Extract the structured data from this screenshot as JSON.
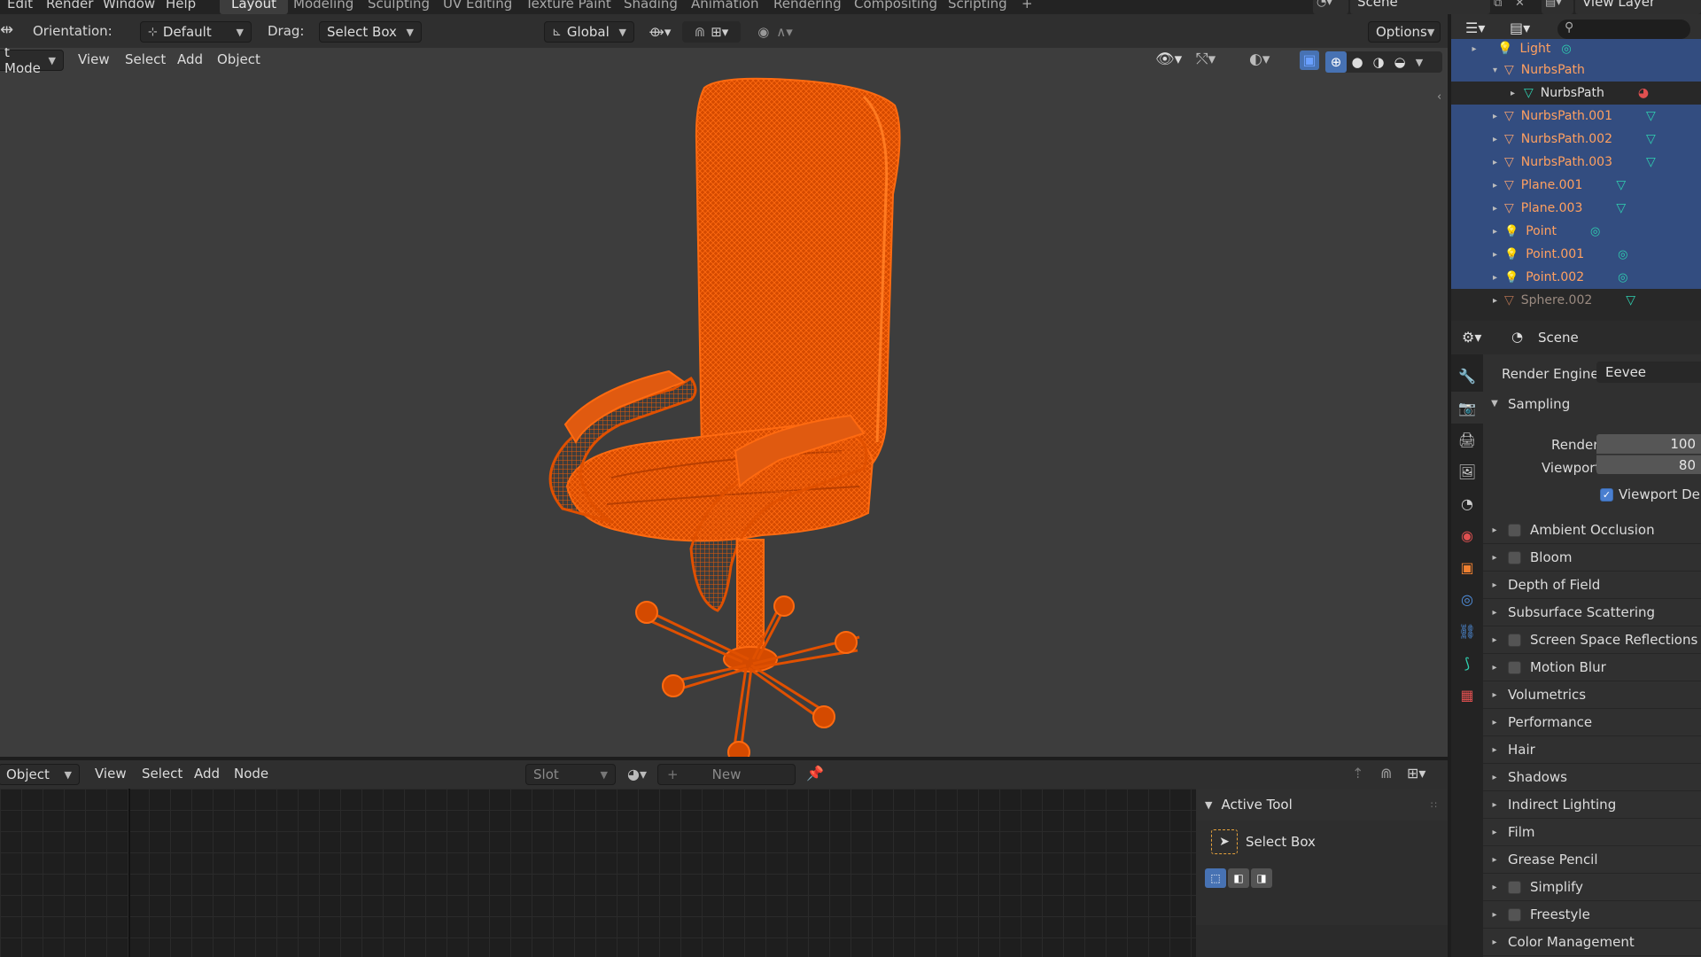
{
  "topbar": {
    "menus": [
      "Edit",
      "Render",
      "Window",
      "Help"
    ],
    "workspaces": [
      {
        "label": "Layout",
        "active": true
      },
      {
        "label": "Modeling",
        "active": false
      },
      {
        "label": "Sculpting",
        "active": false
      },
      {
        "label": "UV Editing",
        "active": false
      },
      {
        "label": "Texture Paint",
        "active": false
      },
      {
        "label": "Shading",
        "active": false
      },
      {
        "label": "Animation",
        "active": false
      },
      {
        "label": "Rendering",
        "active": false
      },
      {
        "label": "Compositing",
        "active": false
      },
      {
        "label": "Scripting",
        "active": false
      }
    ],
    "add_tab": "+",
    "scene_name": "Scene",
    "view_layer": "View Layer"
  },
  "toolhdr": {
    "orientation_label": "Orientation:",
    "orientation_value": "Default",
    "drag_label": "Drag:",
    "drag_value": "Select Box",
    "transform_value": "Global",
    "options_label": "Options"
  },
  "viewport": {
    "mode": "t Mode",
    "menus": [
      "View",
      "Select",
      "Add",
      "Object"
    ],
    "object_color": "#e05000"
  },
  "bottom": {
    "mode": "Object",
    "menus": [
      "View",
      "Select",
      "Add",
      "Node"
    ],
    "slot_label": "Slot",
    "new_label": "New",
    "active_tool_title": "Active Tool",
    "active_tool_name": "Select Box"
  },
  "outliner": {
    "items": [
      {
        "name": "Light",
        "type": "light",
        "sel": true,
        "depth": 0
      },
      {
        "name": "NurbsPath",
        "type": "curve",
        "sel": true,
        "depth": 0,
        "expanded": true
      },
      {
        "name": "NurbsPath",
        "type": "data",
        "sel": false,
        "depth": 1
      },
      {
        "name": "NurbsPath.001",
        "type": "curve",
        "sel": true,
        "depth": 0
      },
      {
        "name": "NurbsPath.002",
        "type": "curve",
        "sel": true,
        "depth": 0
      },
      {
        "name": "NurbsPath.003",
        "type": "curve",
        "sel": true,
        "depth": 0
      },
      {
        "name": "Plane.001",
        "type": "mesh",
        "sel": true,
        "depth": 0
      },
      {
        "name": "Plane.003",
        "type": "mesh",
        "sel": true,
        "depth": 0
      },
      {
        "name": "Point",
        "type": "light",
        "sel": true,
        "depth": 0
      },
      {
        "name": "Point.001",
        "type": "light",
        "sel": true,
        "depth": 0
      },
      {
        "name": "Point.002",
        "type": "light",
        "sel": true,
        "depth": 0
      },
      {
        "name": "Sphere.002",
        "type": "mesh",
        "sel": false,
        "depth": 0
      }
    ]
  },
  "properties": {
    "context": "Scene",
    "render_engine_label": "Render Engine",
    "render_engine_value": "Eevee",
    "sampling_label": "Sampling",
    "render_label": "Render",
    "render_value": "100",
    "viewport_label": "Viewport",
    "viewport_value": "80",
    "viewport_denoise": "Viewport Deno",
    "panels": [
      {
        "label": "Ambient Occlusion",
        "checkbox": true
      },
      {
        "label": "Bloom",
        "checkbox": true
      },
      {
        "label": "Depth of Field",
        "checkbox": false
      },
      {
        "label": "Subsurface Scattering",
        "checkbox": false
      },
      {
        "label": "Screen Space Reflections",
        "checkbox": true
      },
      {
        "label": "Motion Blur",
        "checkbox": true
      },
      {
        "label": "Volumetrics",
        "checkbox": false
      },
      {
        "label": "Performance",
        "checkbox": false
      },
      {
        "label": "Hair",
        "checkbox": false
      },
      {
        "label": "Shadows",
        "checkbox": false
      },
      {
        "label": "Indirect Lighting",
        "checkbox": false
      },
      {
        "label": "Film",
        "checkbox": false
      },
      {
        "label": "Grease Pencil",
        "checkbox": false
      },
      {
        "label": "Simplify",
        "checkbox": true
      },
      {
        "label": "Freestyle",
        "checkbox": true
      },
      {
        "label": "Color Management",
        "checkbox": false
      }
    ]
  }
}
